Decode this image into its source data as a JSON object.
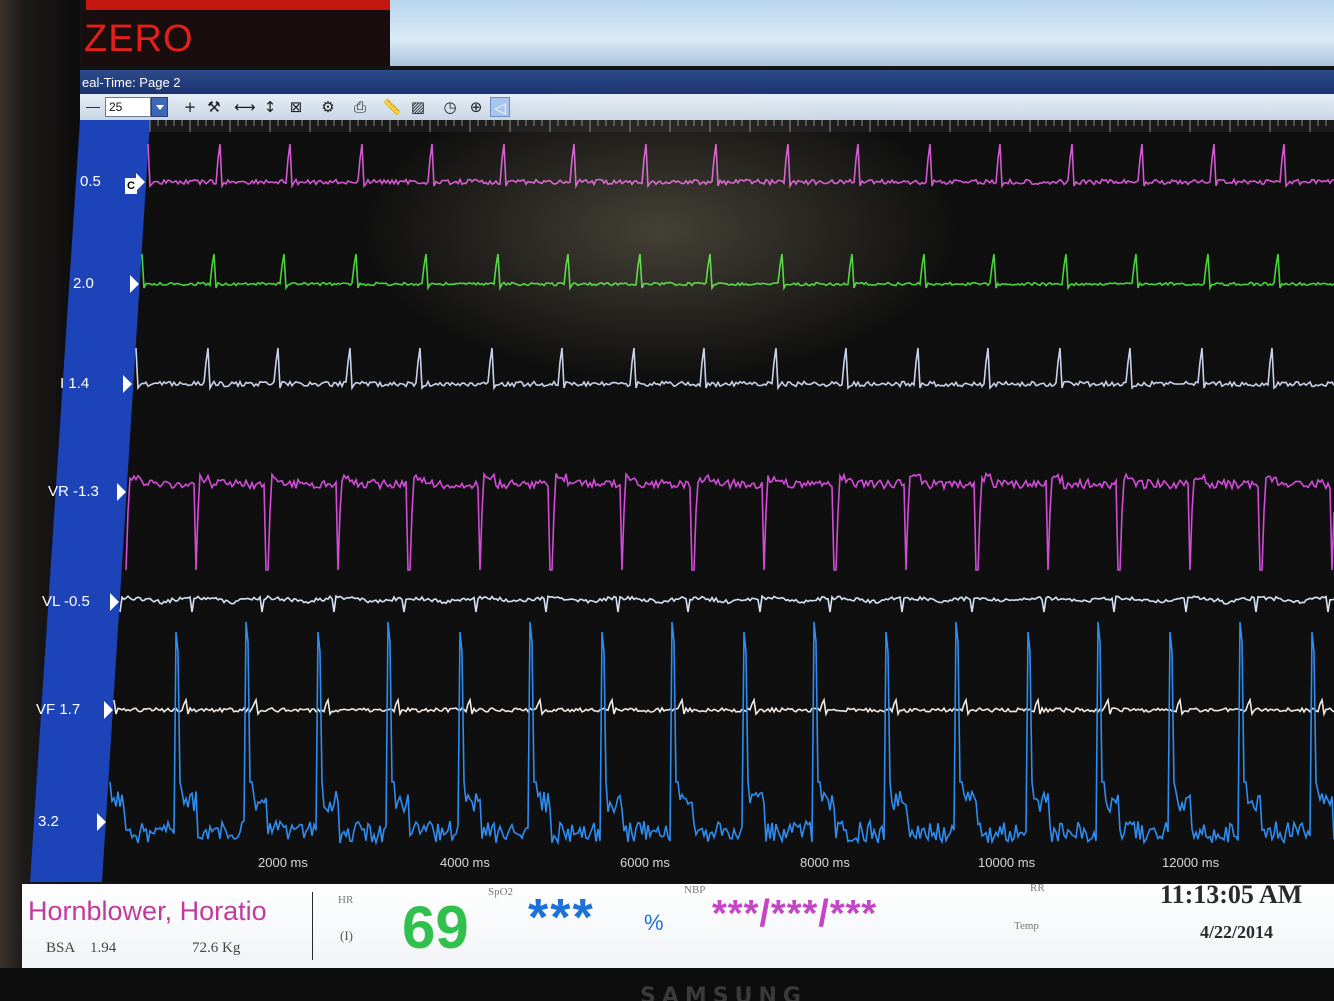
{
  "alarm": {
    "text": "ZERO"
  },
  "window": {
    "title": "eal-Time: Page 2"
  },
  "toolbar": {
    "dash": "—",
    "value": "25",
    "icons": [
      {
        "name": "add-icon",
        "glyph": "+"
      },
      {
        "name": "tools-icon",
        "glyph": "⚒"
      },
      {
        "name": "horizontal-caliper-icon",
        "glyph": "⟷"
      },
      {
        "name": "vertical-caliper-icon",
        "glyph": "↕"
      },
      {
        "name": "zoom-box-icon",
        "glyph": "⊠"
      },
      {
        "name": "sync-icon",
        "glyph": "⚙"
      },
      {
        "name": "print-icon",
        "glyph": "⎙"
      },
      {
        "name": "ruler-icon",
        "glyph": "📏"
      },
      {
        "name": "ruler-grid-icon",
        "glyph": "▨"
      },
      {
        "name": "clock-icon",
        "glyph": "◷"
      },
      {
        "name": "target-icon",
        "glyph": "⊕"
      },
      {
        "name": "sound-icon",
        "glyph": "◁"
      }
    ]
  },
  "leads": [
    {
      "label": "0.5",
      "color": "#d257d0"
    },
    {
      "label": "2.0",
      "color": "#47d43a"
    },
    {
      "label": "I 1.4",
      "color": "#c8d0ea"
    },
    {
      "label": "VR -1.3",
      "color": "#d24cd8"
    },
    {
      "label": "VL -0.5",
      "color": "#d6e2f4"
    },
    {
      "label": "VF 1.7",
      "color": "#f0e8e2"
    },
    {
      "label": "3.2",
      "color": "#2f8cf0"
    }
  ],
  "time_labels": [
    "2000 ms",
    "4000 ms",
    "6000 ms",
    "8000 ms",
    "10000 ms",
    "12000 ms"
  ],
  "patient": {
    "name": "Hornblower, Horatio",
    "bsa_label": "BSA",
    "bsa_value": "1.94",
    "weight": "72.6 Kg"
  },
  "vitals": {
    "hr_label": "HR",
    "hr_lead": "(I)",
    "hr_value": "69",
    "spo2_label": "SpO2",
    "spo2_value": "***",
    "spo2_unit": "%",
    "nbp_label": "NBP",
    "nbp_value": "***/***/***",
    "rr_label": "RR",
    "temp_label": "Temp"
  },
  "clock": {
    "time": "11:13:05 AM",
    "date": "4/22/2014"
  },
  "brand": "SAMSUNG"
}
